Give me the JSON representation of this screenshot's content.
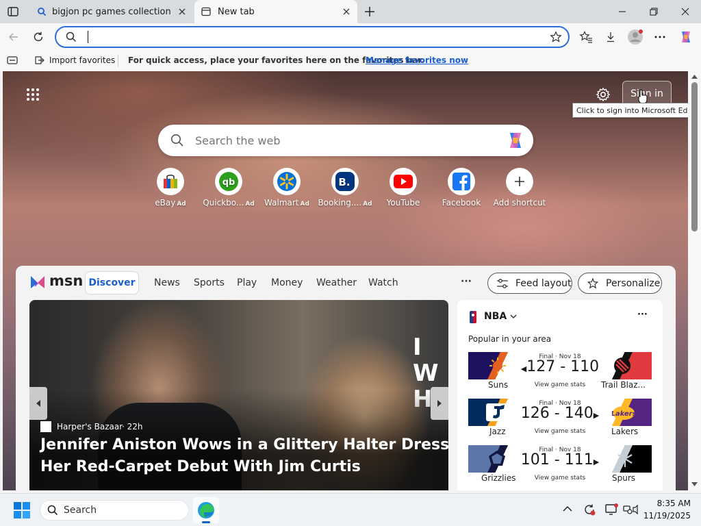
{
  "tabs": [
    {
      "title": "bigjon pc games collection - Search",
      "active": false
    },
    {
      "title": "New tab",
      "active": true
    }
  ],
  "address": {
    "value": "",
    "placeholder": ""
  },
  "favorites_bar": {
    "import_label": "Import favorites",
    "hint": "For quick access, place your favorites here on the favorites bar.",
    "manage_link": "Manage favorites now"
  },
  "ntp": {
    "sign_in_label": "Sign in",
    "tooltip": "Click to sign into Microsoft Edge",
    "search_placeholder": "Search the web",
    "shortcuts": [
      {
        "label": "eBay",
        "ad": "Ad"
      },
      {
        "label": "Quickbo...",
        "ad": "Ad"
      },
      {
        "label": "Walmart",
        "ad": "Ad"
      },
      {
        "label": "Booking....",
        "ad": "Ad"
      },
      {
        "label": "YouTube",
        "ad": ""
      },
      {
        "label": "Facebook",
        "ad": ""
      },
      {
        "label": "Add shortcut",
        "ad": ""
      }
    ]
  },
  "feed": {
    "logo": "msn",
    "nav": [
      "Discover",
      "News",
      "Sports",
      "Play",
      "Money",
      "Weather",
      "Watch"
    ],
    "more": "···",
    "feed_layout_label": "Feed layout",
    "personalize_label": "Personalize",
    "hero": {
      "source": "Harper's Bazaar",
      "age": "· 22h",
      "headline_line1": "Jennifer Aniston Wows in a Glittery Halter Dress for",
      "headline_line2": "Her Red-Carpet Debut With Jim Curtis"
    },
    "nba": {
      "title": "NBA",
      "subtitle": "Popular in your area",
      "more": "···",
      "games": [
        {
          "status": "Final · Nov 18",
          "home": "Suns",
          "away": "Trail Blaz...",
          "score": "127 - 110",
          "stats": "View game stats",
          "left_color": "#1d1160",
          "left_accent": "#e56020",
          "right_color": "#e03a3e",
          "right_accent": "#111111"
        },
        {
          "status": "Final · Nov 18",
          "home": "Jazz",
          "away": "Lakers",
          "score": "126 - 140",
          "stats": "View game stats",
          "left_color": "#002b5c",
          "left_accent": "#f9a01b",
          "right_color": "#552583",
          "right_accent": "#fdb927"
        },
        {
          "status": "Final · Nov 18",
          "home": "Grizzlies",
          "away": "Spurs",
          "score": "101 - 111",
          "stats": "View game stats",
          "left_color": "#5d76a9",
          "left_accent": "#12173f",
          "right_color": "#000000",
          "right_accent": "#c4ced4"
        }
      ]
    }
  },
  "taskbar": {
    "search_label": "Search",
    "time": "8:35 AM",
    "date": "11/19/2025"
  }
}
